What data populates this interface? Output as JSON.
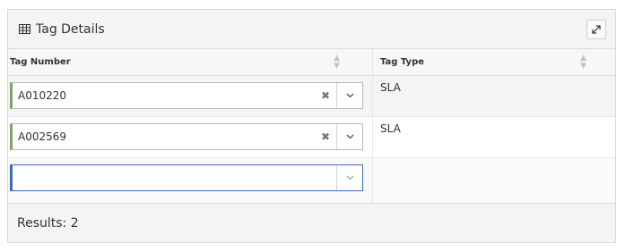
{
  "panel": {
    "title": "Tag Details",
    "title_icon": "grid-icon",
    "expand_icon": "expand-icon"
  },
  "table": {
    "columns": [
      "Tag Number",
      "Tag Type"
    ],
    "sort_icon": "sort-icon",
    "rows": [
      {
        "tag_number": "A010220",
        "tag_type": "SLA"
      },
      {
        "tag_number": "A002569",
        "tag_type": "SLA"
      },
      {
        "tag_number": "",
        "tag_type": ""
      }
    ],
    "clear_icon": "close-icon",
    "dropdown_icon": "chevron-down-icon"
  },
  "footer": {
    "results_text": "Results: 2"
  },
  "colors": {
    "valid_border": "#7aa66a",
    "active_border": "#3c6db0",
    "header_bg": "#f4f4f4"
  }
}
